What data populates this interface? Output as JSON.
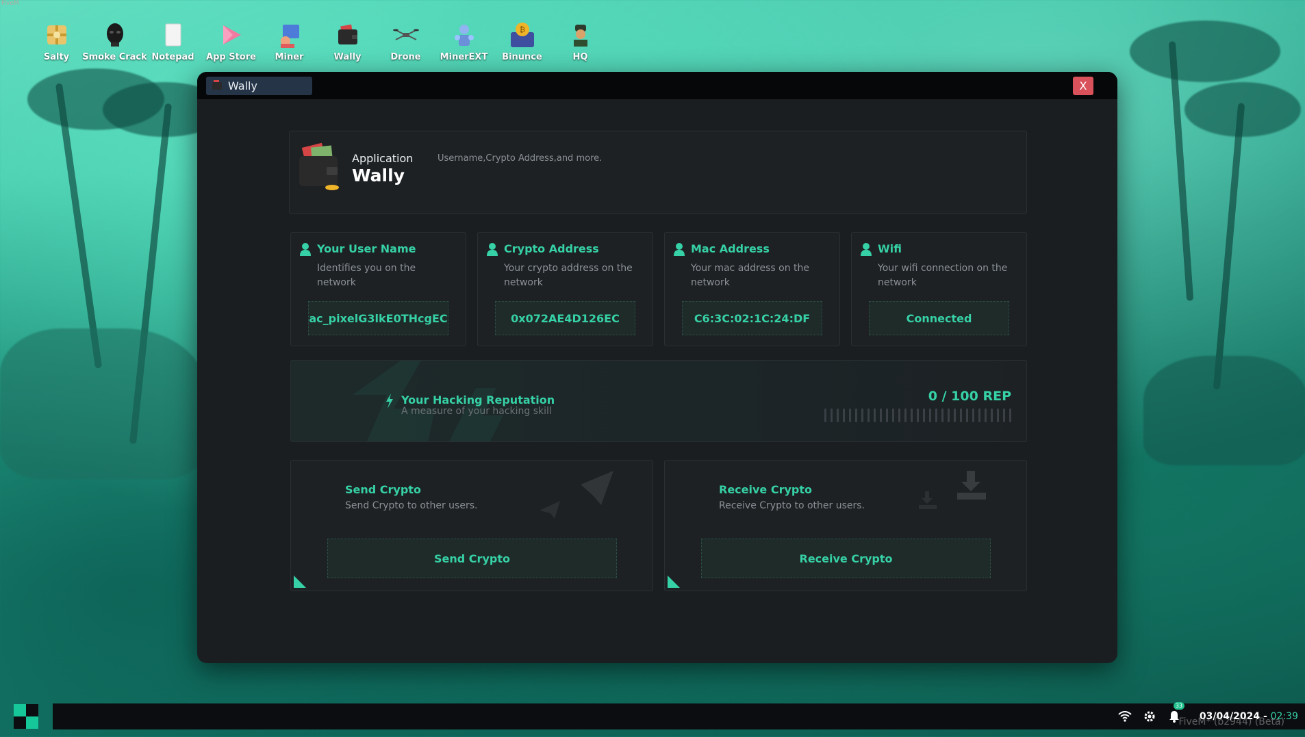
{
  "top_tag": "FiveM",
  "desktop": {
    "icons": [
      {
        "label": "Salty",
        "icon": "salty-icon"
      },
      {
        "label": "Smoke Crack",
        "icon": "smoke-crack-icon"
      },
      {
        "label": "Notepad",
        "icon": "notepad-icon"
      },
      {
        "label": "App Store",
        "icon": "app-store-icon"
      },
      {
        "label": "Miner",
        "icon": "miner-icon"
      },
      {
        "label": "Wally",
        "icon": "wallet-icon"
      },
      {
        "label": "Drone",
        "icon": "drone-icon"
      },
      {
        "label": "MinerEXT",
        "icon": "minerext-icon"
      },
      {
        "label": "Binunce",
        "icon": "binunce-icon"
      },
      {
        "label": "HQ",
        "icon": "hq-icon"
      }
    ]
  },
  "window": {
    "tab_title": "Wally",
    "close_label": "X"
  },
  "header": {
    "kicker": "Application",
    "name": "Wally",
    "description": "Username,Crypto Address,and more."
  },
  "cards": [
    {
      "title": "Your User Name",
      "description": "Identifies you on the network",
      "value": "ac_pixelG3lkE0THcgEC"
    },
    {
      "title": "Crypto Address",
      "description": "Your crypto address on the network",
      "value": "0x072AE4D126EC"
    },
    {
      "title": "Mac Address",
      "description": "Your mac address on the network",
      "value": "C6:3C:02:1C:24:DF"
    },
    {
      "title": "Wifi",
      "description": "Your wifi connection on the network",
      "value": "Connected"
    }
  ],
  "reputation": {
    "title": "Your Hacking Reputation",
    "subtitle": "A measure of your hacking skill",
    "score": "0 / 100 REP",
    "progress": 0
  },
  "actions": [
    {
      "title": "Send Crypto",
      "subtitle": "Send Crypto to other users.",
      "button": "Send Crypto",
      "icon": "paper-plane-icon"
    },
    {
      "title": "Receive Crypto",
      "subtitle": "Receive Crypto to other users.",
      "button": "Receive Crypto",
      "icon": "download-icon"
    }
  ],
  "taskbar": {
    "notification_count": "33",
    "date": "03/04/2024 -",
    "time": "02:39",
    "watermark": "FiveM* (b2944) (Beta)"
  },
  "colors": {
    "accent": "#36d1a6",
    "close": "#d9515a",
    "window_bg": "#1b1e21",
    "title_tab": "#253447"
  }
}
